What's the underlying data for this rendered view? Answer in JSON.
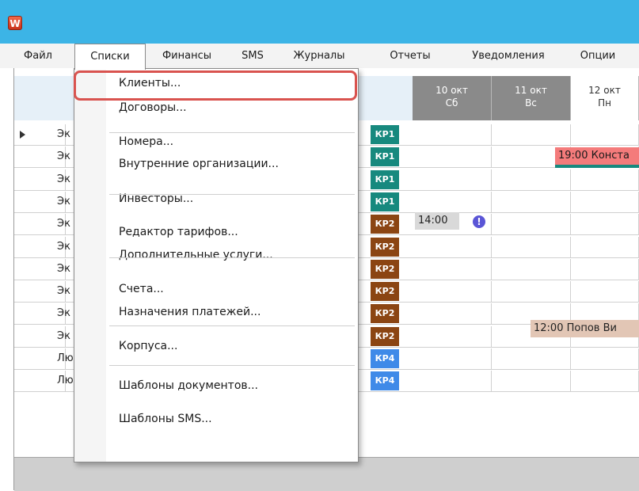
{
  "app": {
    "icon_letter": "W",
    "icon": "app-logo-icon"
  },
  "menubar": [
    {
      "key": "file",
      "label": "Файл"
    },
    {
      "key": "lists",
      "label": "Списки",
      "open": true
    },
    {
      "key": "finance",
      "label": "Финансы"
    },
    {
      "key": "sms",
      "label": "SMS"
    },
    {
      "key": "journals",
      "label": "Журналы"
    },
    {
      "key": "reports",
      "label": "Отчеты"
    },
    {
      "key": "notifications",
      "label": "Уведомления"
    },
    {
      "key": "options",
      "label": "Опции"
    }
  ],
  "dropdown": {
    "items": [
      {
        "label": "Клиенты...",
        "highlighted": true
      },
      {
        "label": "Договоры..."
      },
      {
        "label": "Номера..."
      },
      {
        "label": "Внутренние организации..."
      },
      {
        "label": "Инвесторы..."
      },
      {
        "label": "Редактор тарифов..."
      },
      {
        "label": "Дополнительные услуги..."
      },
      {
        "label": "Счета..."
      },
      {
        "label": "Назначения платежей..."
      },
      {
        "label": "Корпуса..."
      },
      {
        "label": "Шаблоны документов..."
      },
      {
        "label": "Шаблоны SMS..."
      }
    ]
  },
  "dates": [
    {
      "day": "10 окт",
      "dow": "Сб",
      "weekend": true
    },
    {
      "day": "11 окт",
      "dow": "Вс",
      "weekend": true
    },
    {
      "day": "12 окт",
      "dow": "Пн",
      "weekend": false
    }
  ],
  "rows": [
    {
      "label": "Эк",
      "tag": "КР1",
      "tag_class": "kr1",
      "current": true
    },
    {
      "label": "Эк",
      "tag": "КР1",
      "tag_class": "kr1"
    },
    {
      "label": "Эк",
      "tag": "КР1",
      "tag_class": "kr1"
    },
    {
      "label": "Эк",
      "tag": "КР1",
      "tag_class": "kr1"
    },
    {
      "label": "Эк",
      "tag": "КР2",
      "tag_class": "kr2"
    },
    {
      "label": "Эк",
      "tag": "КР2",
      "tag_class": "kr2"
    },
    {
      "label": "Эк",
      "tag": "КР2",
      "tag_class": "kr2"
    },
    {
      "label": "Эк",
      "tag": "КР2",
      "tag_class": "kr2"
    },
    {
      "label": "Эк",
      "tag": "КР2",
      "tag_class": "kr2"
    },
    {
      "label": "Эк",
      "tag": "КР2",
      "tag_class": "kr2"
    },
    {
      "label": "Лю",
      "tag": "КР4",
      "tag_class": "kr4"
    },
    {
      "label": "Лю",
      "tag": "КР4",
      "tag_class": "kr4"
    }
  ],
  "events": {
    "booking_1": "19:00 Конста",
    "booking_2": "14:00",
    "booking_3": "12:00 Попов Ви",
    "alert_glyph": "!"
  },
  "colors": {
    "titlebar": "#3cb4e6",
    "kr1": "#17897e",
    "kr2": "#8b4513",
    "kr4": "#3f8ae8",
    "weekend_header": "#8a8a8a",
    "highlight_border": "#d9534f"
  }
}
